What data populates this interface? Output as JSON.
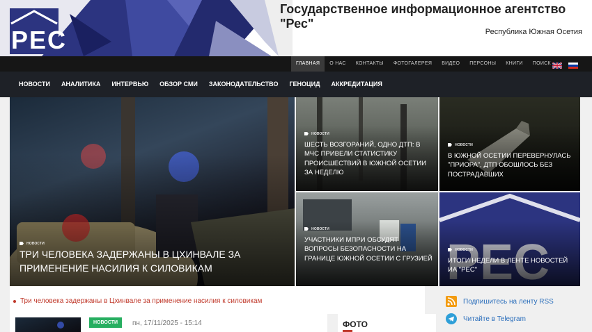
{
  "header": {
    "logo_text": "РЕС",
    "title": "Государственное информационное агентство \"Рес\"",
    "subtitle": "Республика Южная Осетия"
  },
  "top_nav": [
    "ГЛАВНАЯ",
    "О НАС",
    "КОНТАКТЫ",
    "ФОТОГАЛЕРЕЯ",
    "ВИДЕО",
    "ПЕРСОНЫ",
    "КНИГИ",
    "ПОИСК"
  ],
  "main_nav": [
    "НОВОСТИ",
    "АНАЛИТИКА",
    "ИНТЕРВЬЮ",
    "ОБЗОР СМИ",
    "ЗАКОНОДАТЕЛЬСТВО",
    "ГЕНОЦИД",
    "АККРЕДИТАЦИЯ"
  ],
  "tiles": [
    {
      "category": "новости",
      "title": "Три человека задержаны в Цхинвале за применение насилия к силовикам"
    },
    {
      "category": "новости",
      "title": "Шесть возгораний, одно ДТП: в МЧС привели статистику происшествий в Южной Осетии за неделю"
    },
    {
      "category": "новости",
      "title": "В Южной Осетии перевернулась \"Приора\", ДТП обошлось без пострадавших"
    },
    {
      "category": "новости",
      "title": "Участники МПРИ обсудят вопросы безопасности на границе Южной Осетии с Грузией"
    },
    {
      "category": "новости",
      "title": "Итоги недели в ленте новостей ИА \"Рес\""
    }
  ],
  "ticker": "Три человека задержаны в Цхинвале за применение насилия к силовикам",
  "news_card": {
    "badge": "НОВОСТИ",
    "date": "пн, 17/11/2025 - 15:14"
  },
  "photo": {
    "label": "ФОТО"
  },
  "sidebar": {
    "rss": "Подпишитесь на ленту RSS",
    "telegram": "Читайте в Telegram"
  },
  "colors": {
    "brand_blue": "#2c3480",
    "accent_red": "#c0392b",
    "badge_green": "#27ae60"
  }
}
